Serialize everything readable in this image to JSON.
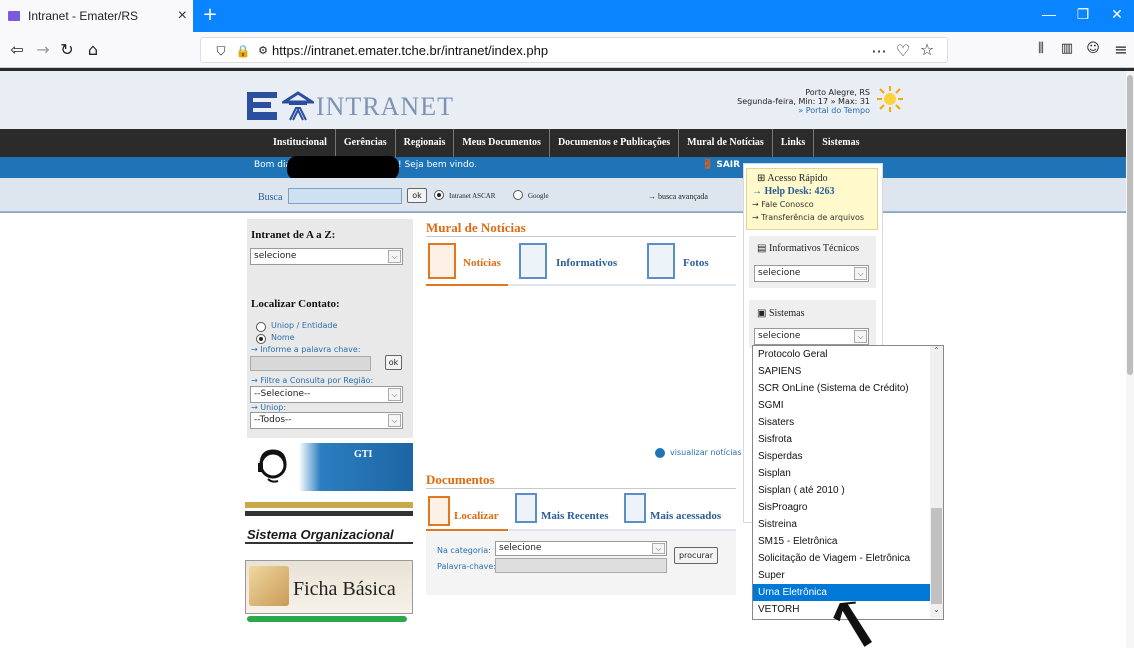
{
  "browser": {
    "tab_title": "Intranet - Emater/RS",
    "tab_close": "×",
    "new_tab": "+",
    "url": "https://intranet.emater.tche.br/intranet/index.php",
    "url_dots": "···",
    "icons": [
      "back-icon",
      "forward-icon",
      "reload-icon",
      "home-icon",
      "shield-icon",
      "lock-warning-icon",
      "pocket-icon",
      "bookmark-star-icon",
      "library-icon",
      "sidebar-icon",
      "account-icon",
      "menu-icon"
    ]
  },
  "header": {
    "logo_text": "INTRANET",
    "city": "Porto Alegre, RS",
    "weather": "Segunda-feira, Min: 17 » Max: 31",
    "weather_link": "» Portal do Tempo"
  },
  "menu": [
    "Institucional",
    "Gerências",
    "Regionais",
    "Meus Documentos",
    "Documentos e Publicações",
    "Mural de Notícias",
    "Links",
    "Sistemas"
  ],
  "greeting": {
    "prefix": "Bom dia",
    "suffix": "! Seja bem vindo.",
    "logout": "SAIR"
  },
  "search": {
    "label": "Busca",
    "ok": "ok",
    "opt_ascar": "Intranet ASCAR",
    "opt_google": "Google",
    "advanced": "→ busca avançada"
  },
  "left": {
    "az_title": "Intranet de A a Z:",
    "az_value": "selecione",
    "contato_title": "Localizar Contato:",
    "opt_uniop": "Uniop / Entidade",
    "opt_nome": "Nome",
    "informe": "→ Informe a palavra chave:",
    "ok": "ok",
    "filtre": "→ Filtre a Consulta por Região:",
    "regiao_value": "--Selecione--",
    "uniop_label": "→ Uniop:",
    "uniop_value": "--Todos--",
    "gti": "GTI",
    "sisorg": "Sistema Organizacional",
    "ficha": "Ficha Básica"
  },
  "center": {
    "mural_title": "Mural de Notícias",
    "tab_noticias": "Notícias",
    "tab_informativos": "Informativos",
    "tab_fotos": "Fotos",
    "visualizar": "visualizar notícias",
    "doc_title": "Documentos",
    "tab_localizar": "Localizar",
    "tab_recentes": "Mais Recentes",
    "tab_acessados": "Mais acessados",
    "lbl_categoria": "Na categoria:",
    "categoria_value": "selecione",
    "lbl_palavra": "Palavra-chave:",
    "procurar": "procurar"
  },
  "right": {
    "acesso_title": "Acesso Rápido",
    "helpdesk": "→ Help Desk: 4263",
    "fale": "→ Fale Conosco",
    "transf": "→ Transferência de arquivos",
    "inf_title": "Informativos Técnicos",
    "inf_value": "selecione",
    "sis_title": "Sistemas",
    "sis_value": "selecione"
  },
  "dropdown_options": [
    "Protocolo Geral",
    "SAPIENS",
    "SCR OnLine (Sistema de Crédito)",
    "SGMI",
    "Sisaters",
    "Sisfrota",
    "Sisperdas",
    "Sisplan",
    "Sisplan ( até 2010 )",
    "SisProagro",
    "Sistreina",
    "SM15 - Eletrônica",
    "Solicitação de Viagem - Eletrônica",
    "Super",
    "Urna Eletrônica",
    "VETORH"
  ],
  "dropdown_selected": "Urna Eletrônica",
  "colors": {
    "accent": "#0a84ff",
    "menu": "#2b2b2b",
    "bluebar": "#1f73b7",
    "orange": "#e06a10"
  }
}
